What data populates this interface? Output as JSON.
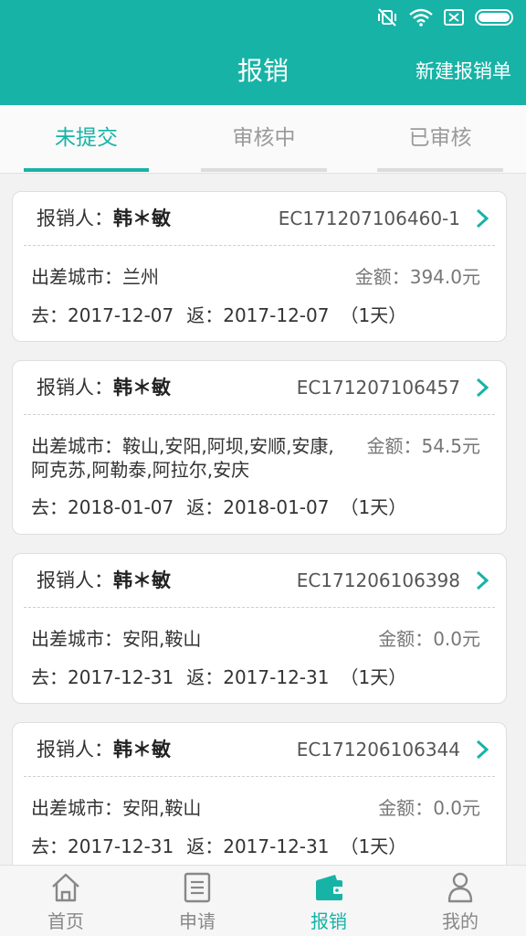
{
  "colors": {
    "primary": "#17b3a6",
    "text": "#333333",
    "muted": "#9a9a9a"
  },
  "status_bar": {
    "icons": [
      "mute-vibrate-icon",
      "wifi-icon",
      "sim-icon",
      "battery-icon"
    ]
  },
  "header": {
    "title": "报销",
    "action_label": "新建报销单"
  },
  "tabs": [
    {
      "label": "未提交",
      "active": true
    },
    {
      "label": "审核中",
      "active": false
    },
    {
      "label": "已审核",
      "active": false
    }
  ],
  "labels": {
    "claimant": "报销人：",
    "city": "出差城市：",
    "amount": "金额：",
    "depart": "去：",
    "return": "返："
  },
  "claims": [
    {
      "claimant": "韩＊敏",
      "code": "EC171207106460-1",
      "cities": "兰州",
      "amount": "394.0元",
      "depart_date": "2017-12-07",
      "return_date": "2017-12-07",
      "duration": "（1天）"
    },
    {
      "claimant": "韩＊敏",
      "code": "EC171207106457",
      "cities": "鞍山,安阳,阿坝,安顺,安康,阿克苏,阿勒泰,阿拉尔,安庆",
      "cities_line1": "鞍山,安阳,阿坝,安顺,安康,",
      "cities_line2": "阿克苏,阿勒泰,阿拉尔,安庆",
      "amount": "54.5元",
      "depart_date": "2018-01-07",
      "return_date": "2018-01-07",
      "duration": "（1天）"
    },
    {
      "claimant": "韩＊敏",
      "code": "EC171206106398",
      "cities": "安阳,鞍山",
      "amount": "0.0元",
      "depart_date": "2017-12-31",
      "return_date": "2017-12-31",
      "duration": "（1天）"
    },
    {
      "claimant": "韩＊敏",
      "code": "EC171206106344",
      "cities": "安阳,鞍山",
      "amount": "0.0元",
      "depart_date": "2017-12-31",
      "return_date": "2017-12-31",
      "duration": "（1天）"
    }
  ],
  "bottom_nav": [
    {
      "label": "首页",
      "icon": "home-icon",
      "active": false
    },
    {
      "label": "申请",
      "icon": "document-icon",
      "active": false
    },
    {
      "label": "报销",
      "icon": "wallet-icon",
      "active": true
    },
    {
      "label": "我的",
      "icon": "person-icon",
      "active": false
    }
  ]
}
